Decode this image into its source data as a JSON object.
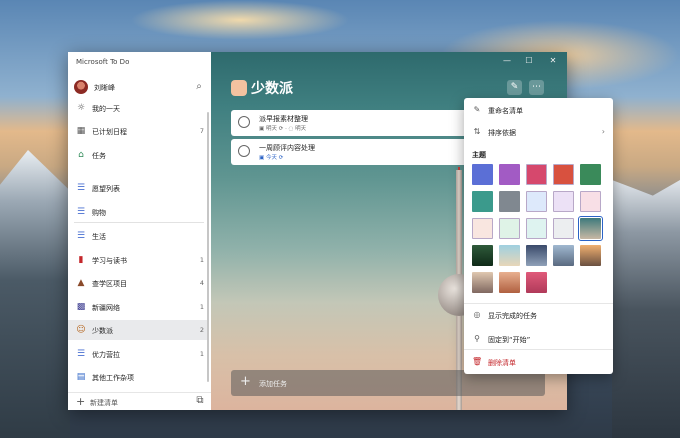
{
  "app": {
    "title": "Microsoft To Do"
  },
  "user": {
    "name": "刘晰峰"
  },
  "sidebar": {
    "items": [
      {
        "label": "我的一天",
        "count": "",
        "icon": "sun-icon",
        "color": "#555555"
      },
      {
        "label": "已计划日程",
        "count": "7",
        "icon": "calendar-icon",
        "color": "#555555"
      },
      {
        "label": "任务",
        "count": "",
        "icon": "home-icon",
        "color": "#2e8b57"
      },
      {
        "label": "愿望列表",
        "count": "",
        "icon": "list-icon",
        "color": "#4a6fd1"
      },
      {
        "label": "购物",
        "count": "",
        "icon": "list-icon",
        "color": "#4a6fd1"
      },
      {
        "label": "生活",
        "count": "",
        "icon": "list-icon",
        "color": "#4a6fd1"
      },
      {
        "label": "学习与读书",
        "count": "1",
        "icon": "book-icon",
        "color": "#c4272b"
      },
      {
        "label": "查学区项目",
        "count": "4",
        "icon": "school-icon",
        "color": "#8a4a2a"
      },
      {
        "label": "新疆网络",
        "count": "1",
        "icon": "clinic-icon",
        "color": "#3b3b8f"
      },
      {
        "label": "少数派",
        "count": "2",
        "icon": "person-emoji-icon",
        "color": "#b5651d"
      },
      {
        "label": "优力营拉",
        "count": "1",
        "icon": "list-icon",
        "color": "#4a6fd1"
      },
      {
        "label": "其他工作杂项",
        "count": "",
        "icon": "note-icon",
        "color": "#2b63c6"
      }
    ],
    "new_list": "新建清单"
  },
  "main": {
    "list_name": "少数派",
    "tasks": [
      {
        "title": "派早报素材整理",
        "meta": "明天",
        "meta2": "明天"
      },
      {
        "title": "一周顾评内容处理",
        "meta": "今天",
        "meta2": ""
      }
    ],
    "add_task": "添加任务"
  },
  "menu": {
    "rename": "重命名清单",
    "sort": "排序依据",
    "theme_heading": "主题",
    "show_completed": "显示完成的任务",
    "pin": "固定到“开始”",
    "delete": "删除清单",
    "themes": [
      "#5b6fd6",
      "#a25bc4",
      "#d6486d",
      "#d8513f",
      "#3a8a5a",
      "#3b9a8c",
      "#808890",
      "#dde9fb",
      "#ece1f6",
      "#f8dfe6",
      "#f9e6e0",
      "#dff3e7",
      "#def3f0",
      "#eceef0",
      "photo-tower",
      "photo-forest",
      "photo-beach",
      "photo-lake",
      "photo-desert",
      "photo-sunset",
      "photo-pier",
      "photo-dunes",
      "photo-pink"
    ]
  }
}
